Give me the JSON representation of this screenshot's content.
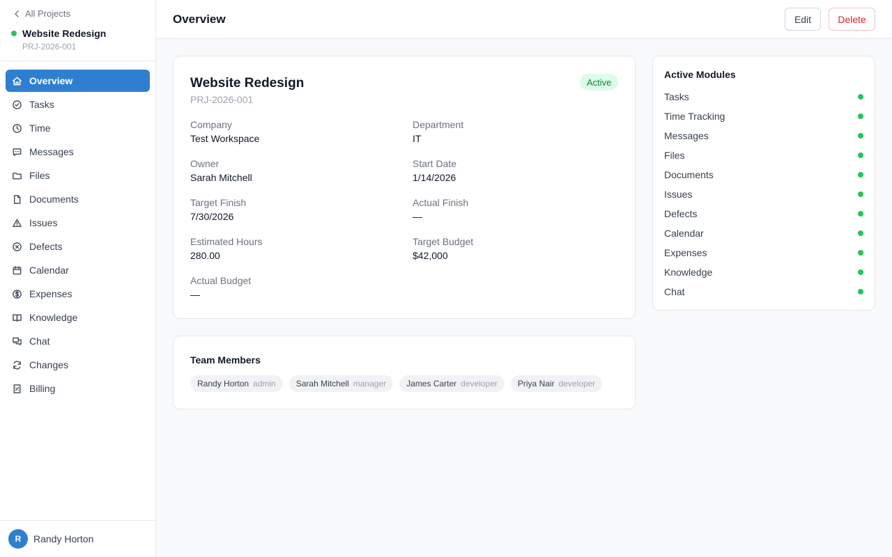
{
  "sidebar": {
    "back_label": "All Projects",
    "project_name": "Website Redesign",
    "project_code": "PRJ-2026-001",
    "status_color": "#22c55e",
    "items": [
      {
        "label": "Overview",
        "icon": "home-icon",
        "active": true
      },
      {
        "label": "Tasks",
        "icon": "check-circle-icon"
      },
      {
        "label": "Time",
        "icon": "clock-icon"
      },
      {
        "label": "Messages",
        "icon": "message-icon"
      },
      {
        "label": "Files",
        "icon": "folder-icon"
      },
      {
        "label": "Documents",
        "icon": "document-icon"
      },
      {
        "label": "Issues",
        "icon": "warning-icon"
      },
      {
        "label": "Defects",
        "icon": "x-circle-icon"
      },
      {
        "label": "Calendar",
        "icon": "calendar-icon"
      },
      {
        "label": "Expenses",
        "icon": "dollar-icon"
      },
      {
        "label": "Knowledge",
        "icon": "book-icon"
      },
      {
        "label": "Chat",
        "icon": "chat-icon"
      },
      {
        "label": "Changes",
        "icon": "refresh-icon"
      },
      {
        "label": "Billing",
        "icon": "receipt-icon"
      }
    ],
    "user": {
      "initial": "R",
      "name": "Randy Horton"
    }
  },
  "header": {
    "title": "Overview",
    "edit_label": "Edit",
    "delete_label": "Delete"
  },
  "project": {
    "name": "Website Redesign",
    "code": "PRJ-2026-001",
    "status": "Active",
    "fields": [
      {
        "label": "Company",
        "value": "Test Workspace"
      },
      {
        "label": "Department",
        "value": "IT"
      },
      {
        "label": "Owner",
        "value": "Sarah Mitchell"
      },
      {
        "label": "Start Date",
        "value": "1/14/2026"
      },
      {
        "label": "Target Finish",
        "value": "7/30/2026"
      },
      {
        "label": "Actual Finish",
        "value": "—"
      },
      {
        "label": "Estimated Hours",
        "value": "280.00"
      },
      {
        "label": "Target Budget",
        "value": "$42,000"
      },
      {
        "label": "Actual Budget",
        "value": "—"
      }
    ]
  },
  "team": {
    "title": "Team Members",
    "members": [
      {
        "name": "Randy Horton",
        "role": "admin"
      },
      {
        "name": "Sarah Mitchell",
        "role": "manager"
      },
      {
        "name": "James Carter",
        "role": "developer"
      },
      {
        "name": "Priya Nair",
        "role": "developer"
      }
    ]
  },
  "modules": {
    "title": "Active Modules",
    "items": [
      "Tasks",
      "Time Tracking",
      "Messages",
      "Files",
      "Documents",
      "Issues",
      "Defects",
      "Calendar",
      "Expenses",
      "Knowledge",
      "Chat"
    ]
  },
  "colors": {
    "accent": "#2f7fd1",
    "active_green": "#22c55e",
    "delete_red": "#dc2626"
  }
}
